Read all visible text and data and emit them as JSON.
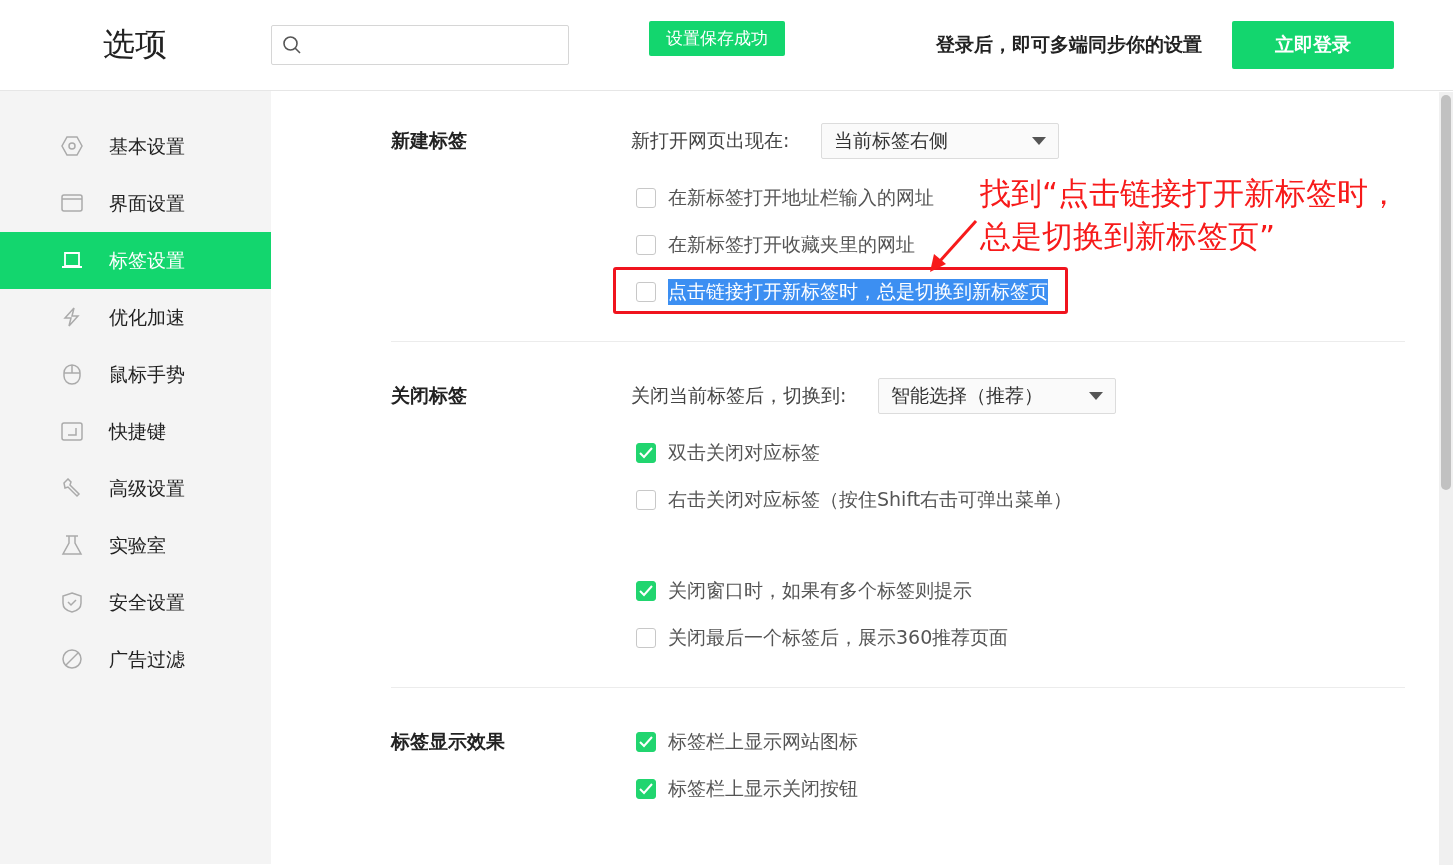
{
  "header": {
    "title": "选项",
    "toast": "设置保存成功",
    "login_hint": "登录后，即可多端同步你的设置",
    "login_button": "立即登录"
  },
  "sidebar": {
    "items": [
      {
        "label": "基本设置",
        "selected": false
      },
      {
        "label": "界面设置",
        "selected": false
      },
      {
        "label": "标签设置",
        "selected": true
      },
      {
        "label": "优化加速",
        "selected": false
      },
      {
        "label": "鼠标手势",
        "selected": false
      },
      {
        "label": "快捷键",
        "selected": false
      },
      {
        "label": "高级设置",
        "selected": false
      },
      {
        "label": "实验室",
        "selected": false
      },
      {
        "label": "安全设置",
        "selected": false
      },
      {
        "label": "广告过滤",
        "selected": false
      }
    ]
  },
  "sections": [
    {
      "title": "新建标签",
      "dropdown": {
        "label": "新打开网页出现在:",
        "value": "当前标签右侧"
      },
      "groups": [
        [
          {
            "label": "在新标签打开地址栏输入的网址",
            "checked": false,
            "highlighted": false
          },
          {
            "label": "在新标签打开收藏夹里的网址",
            "checked": false,
            "highlighted": false
          },
          {
            "label": "点击链接打开新标签时，总是切换到新标签页",
            "checked": false,
            "highlighted": true
          }
        ]
      ]
    },
    {
      "title": "关闭标签",
      "dropdown": {
        "label": "关闭当前标签后，切换到:",
        "value": "智能选择（推荐）"
      },
      "groups": [
        [
          {
            "label": "双击关闭对应标签",
            "checked": true,
            "highlighted": false
          },
          {
            "label": "右击关闭对应标签（按住Shift右击可弹出菜单）",
            "checked": false,
            "highlighted": false
          }
        ],
        [
          {
            "label": "关闭窗口时，如果有多个标签则提示",
            "checked": true,
            "highlighted": false
          },
          {
            "label": "关闭最后一个标签后，展示360推荐页面",
            "checked": false,
            "highlighted": false
          }
        ]
      ]
    },
    {
      "title": "标签显示效果",
      "groups": [
        [
          {
            "label": "标签栏上显示网站图标",
            "checked": true,
            "highlighted": false
          },
          {
            "label": "标签栏上显示关闭按钮",
            "checked": true,
            "highlighted": false
          }
        ]
      ]
    }
  ],
  "annotation": {
    "lines": [
      "找到“点击链接打开新标签时，",
      "总是切换到新标签页”"
    ]
  }
}
